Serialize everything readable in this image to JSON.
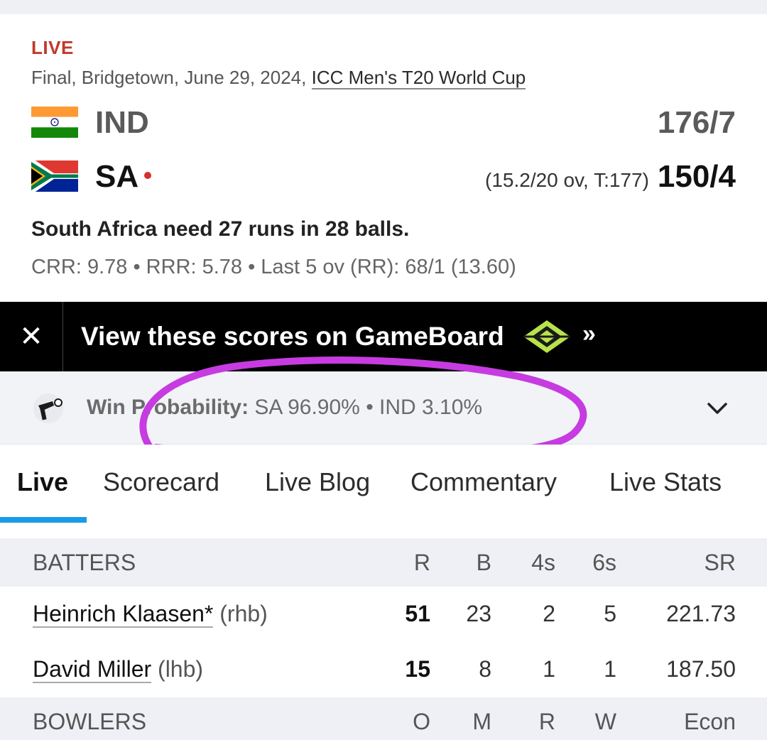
{
  "match": {
    "status": "LIVE",
    "info": "Final, Bridgetown, June 29, 2024, ",
    "series": "ICC Men's T20 World Cup",
    "teams": [
      {
        "name": "IND",
        "score": "176/7",
        "detail": ""
      },
      {
        "name": "SA",
        "score": "150/4",
        "detail": "(15.2/20 ov, T:177)"
      }
    ],
    "need": "South Africa need 27 runs in 28 balls.",
    "rates": "CRR: 9.78 • RRR: 5.78 • Last 5 ov (RR): 68/1 (13.60)"
  },
  "banner": {
    "text": "View these scores on GameBoard",
    "close_icon": "close-icon",
    "chevron": "»"
  },
  "win_probability": {
    "label": "Win Probability:",
    "value": "SA 96.90% • IND 3.10%"
  },
  "tabs": [
    "Live",
    "Scorecard",
    "Live Blog",
    "Commentary",
    "Live Stats"
  ],
  "batters": {
    "header": [
      "BATTERS",
      "R",
      "B",
      "4s",
      "6s",
      "SR"
    ],
    "rows": [
      {
        "name": "Heinrich Klaasen*",
        "hand": "(rhb)",
        "r": "51",
        "b": "23",
        "fours": "2",
        "sixes": "5",
        "sr": "221.73"
      },
      {
        "name": "David Miller",
        "hand": "(lhb)",
        "r": "15",
        "b": "8",
        "fours": "1",
        "sixes": "1",
        "sr": "187.50"
      }
    ]
  },
  "bowlers": {
    "header": [
      "BOWLERS",
      "O",
      "M",
      "R",
      "W",
      "Econ"
    ]
  },
  "colors": {
    "live": "#c0392b",
    "tab_active_underline": "#1a9be6",
    "annotation": "#c63ce0",
    "banner_bg": "#000000"
  }
}
